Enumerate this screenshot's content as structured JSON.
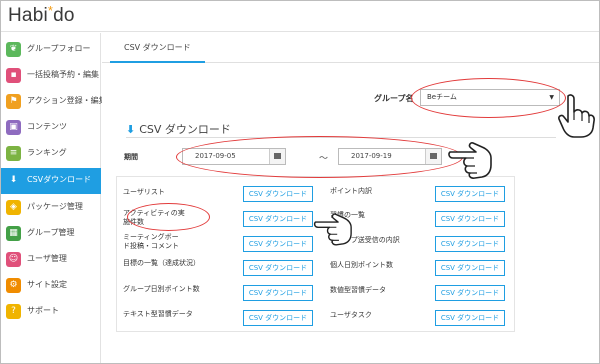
{
  "header": {
    "logo_main": "Habi",
    "logo_star": "*",
    "logo_tail": "do"
  },
  "sidebar": {
    "items": [
      {
        "label": "グループフォロー",
        "icon": "leaf-icon",
        "color": "#5cb85c"
      },
      {
        "label": "一括投稿予約・編集",
        "icon": "chat-icon",
        "color": "#e0507a"
      },
      {
        "label": "アクション登録・編集",
        "icon": "flag-icon",
        "color": "#f0a020"
      },
      {
        "label": "コンテンツ",
        "icon": "content-icon",
        "color": "#8e6bbf"
      },
      {
        "label": "ランキング",
        "icon": "ranking-icon",
        "color": "#7cb342"
      },
      {
        "label": "CSVダウンロード",
        "icon": "download-icon",
        "color": "#1f9ee2"
      },
      {
        "label": "パッケージ管理",
        "icon": "package-icon",
        "color": "#f0b400"
      },
      {
        "label": "グループ管理",
        "icon": "group-icon",
        "color": "#43a047"
      },
      {
        "label": "ユーザ管理",
        "icon": "user-icon",
        "color": "#e0507a"
      },
      {
        "label": "サイト設定",
        "icon": "gear-icon",
        "color": "#f08c00"
      },
      {
        "label": "サポート",
        "icon": "help-icon",
        "color": "#f0b400"
      }
    ]
  },
  "main": {
    "tab_label": "CSV ダウンロード",
    "group_label": "グループ名",
    "group_value": "Beチーム",
    "section_title": "CSV ダウンロード",
    "period_label": "期間",
    "date_from": "2017-09-05",
    "date_to": "2017-09-19",
    "separator": "～",
    "button_label": "CSV ダウンロード",
    "left_rows": [
      {
        "label": "ユーザリスト"
      },
      {
        "label": "アクティビティの実施件数"
      },
      {
        "label": "ミーティングボード投稿・コメント"
      },
      {
        "label": "目標の一覧（達成状況）"
      },
      {
        "label": "グループ日別ポイント数"
      },
      {
        "label": "テキスト型習慣データ"
      }
    ],
    "right_rows": [
      {
        "label": "ポイント内訳"
      },
      {
        "label": "習慣の一覧"
      },
      {
        "label": "スタンプ送受信の内訳"
      },
      {
        "label": "個人日別ポイント数"
      },
      {
        "label": "数値型習慣データ"
      },
      {
        "label": "ユーザタスク"
      }
    ]
  },
  "annotation_color": "#e23b3b"
}
